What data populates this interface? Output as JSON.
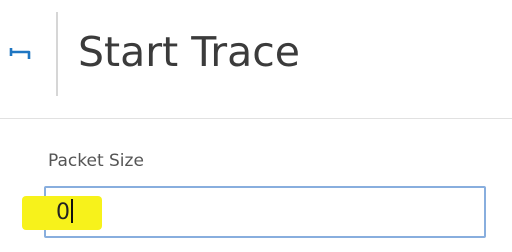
{
  "header": {
    "title": "Start Trace",
    "back_icon": "back-arrow-icon",
    "accent_color": "#1f76c2"
  },
  "form": {
    "packet_size": {
      "label": "Packet Size",
      "value": "0",
      "border_color": "#88aede",
      "highlight_color": "#f7f21b"
    }
  }
}
